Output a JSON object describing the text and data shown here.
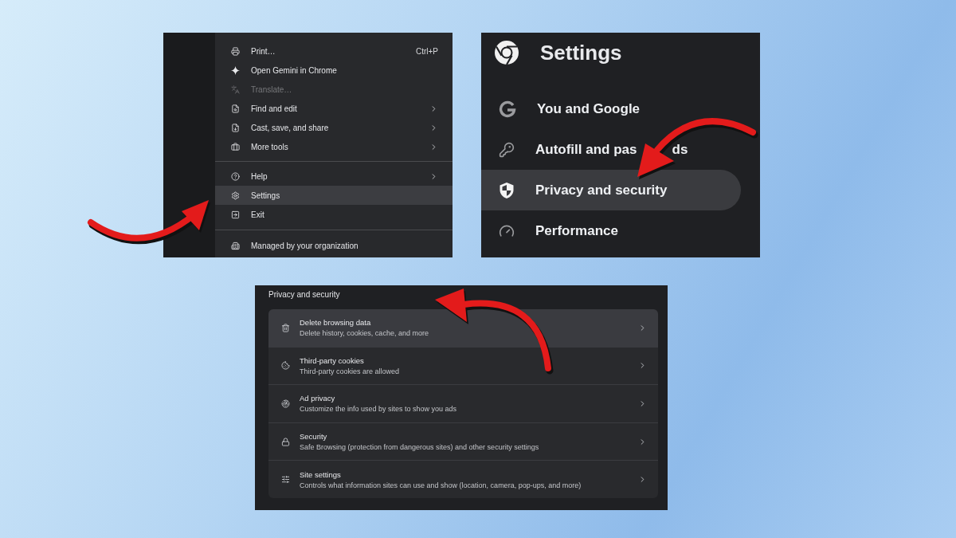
{
  "menu_panel": {
    "items": [
      {
        "kind": "item",
        "label": "Print…",
        "shortcut": "Ctrl+P",
        "disabled": false,
        "selected": false,
        "submenu": false
      },
      {
        "kind": "item",
        "label": "Open Gemini in Chrome",
        "disabled": false,
        "selected": false,
        "submenu": false
      },
      {
        "kind": "item",
        "label": "Translate…",
        "disabled": true,
        "selected": false,
        "submenu": false
      },
      {
        "kind": "item",
        "label": "Find and edit",
        "disabled": false,
        "selected": false,
        "submenu": true
      },
      {
        "kind": "item",
        "label": "Cast, save, and share",
        "disabled": false,
        "selected": false,
        "submenu": true
      },
      {
        "kind": "item",
        "label": "More tools",
        "disabled": false,
        "selected": false,
        "submenu": true
      },
      {
        "kind": "separator"
      },
      {
        "kind": "item",
        "label": "Help",
        "disabled": false,
        "selected": false,
        "submenu": true
      },
      {
        "kind": "item",
        "label": "Settings",
        "disabled": false,
        "selected": true,
        "submenu": false
      },
      {
        "kind": "item",
        "label": "Exit",
        "disabled": false,
        "selected": false,
        "submenu": false
      },
      {
        "kind": "separator"
      },
      {
        "kind": "item",
        "label": "Managed by your organization",
        "disabled": false,
        "selected": false,
        "submenu": false
      }
    ]
  },
  "settings_panel": {
    "title": "Settings",
    "nav": [
      {
        "label": "You and Google",
        "selected": false
      },
      {
        "label": "Autofill and pas",
        "label_tail": "ds",
        "selected": false
      },
      {
        "label": "Privacy and security",
        "selected": true
      },
      {
        "label": "Performance",
        "selected": false
      }
    ]
  },
  "privacy_panel": {
    "title": "Privacy and security",
    "rows": [
      {
        "title": "Delete browsing data",
        "subtitle": "Delete history, cookies, cache, and more",
        "selected": true
      },
      {
        "title": "Third-party cookies",
        "subtitle": "Third-party cookies are allowed",
        "selected": false
      },
      {
        "title": "Ad privacy",
        "subtitle": "Customize the info used by sites to show you ads",
        "selected": false
      },
      {
        "title": "Security",
        "subtitle": "Safe Browsing (protection from dangerous sites) and other security settings",
        "selected": false
      },
      {
        "title": "Site settings",
        "subtitle": "Controls what information sites can use and show (location, camera, pop-ups, and more)",
        "selected": false
      }
    ]
  }
}
